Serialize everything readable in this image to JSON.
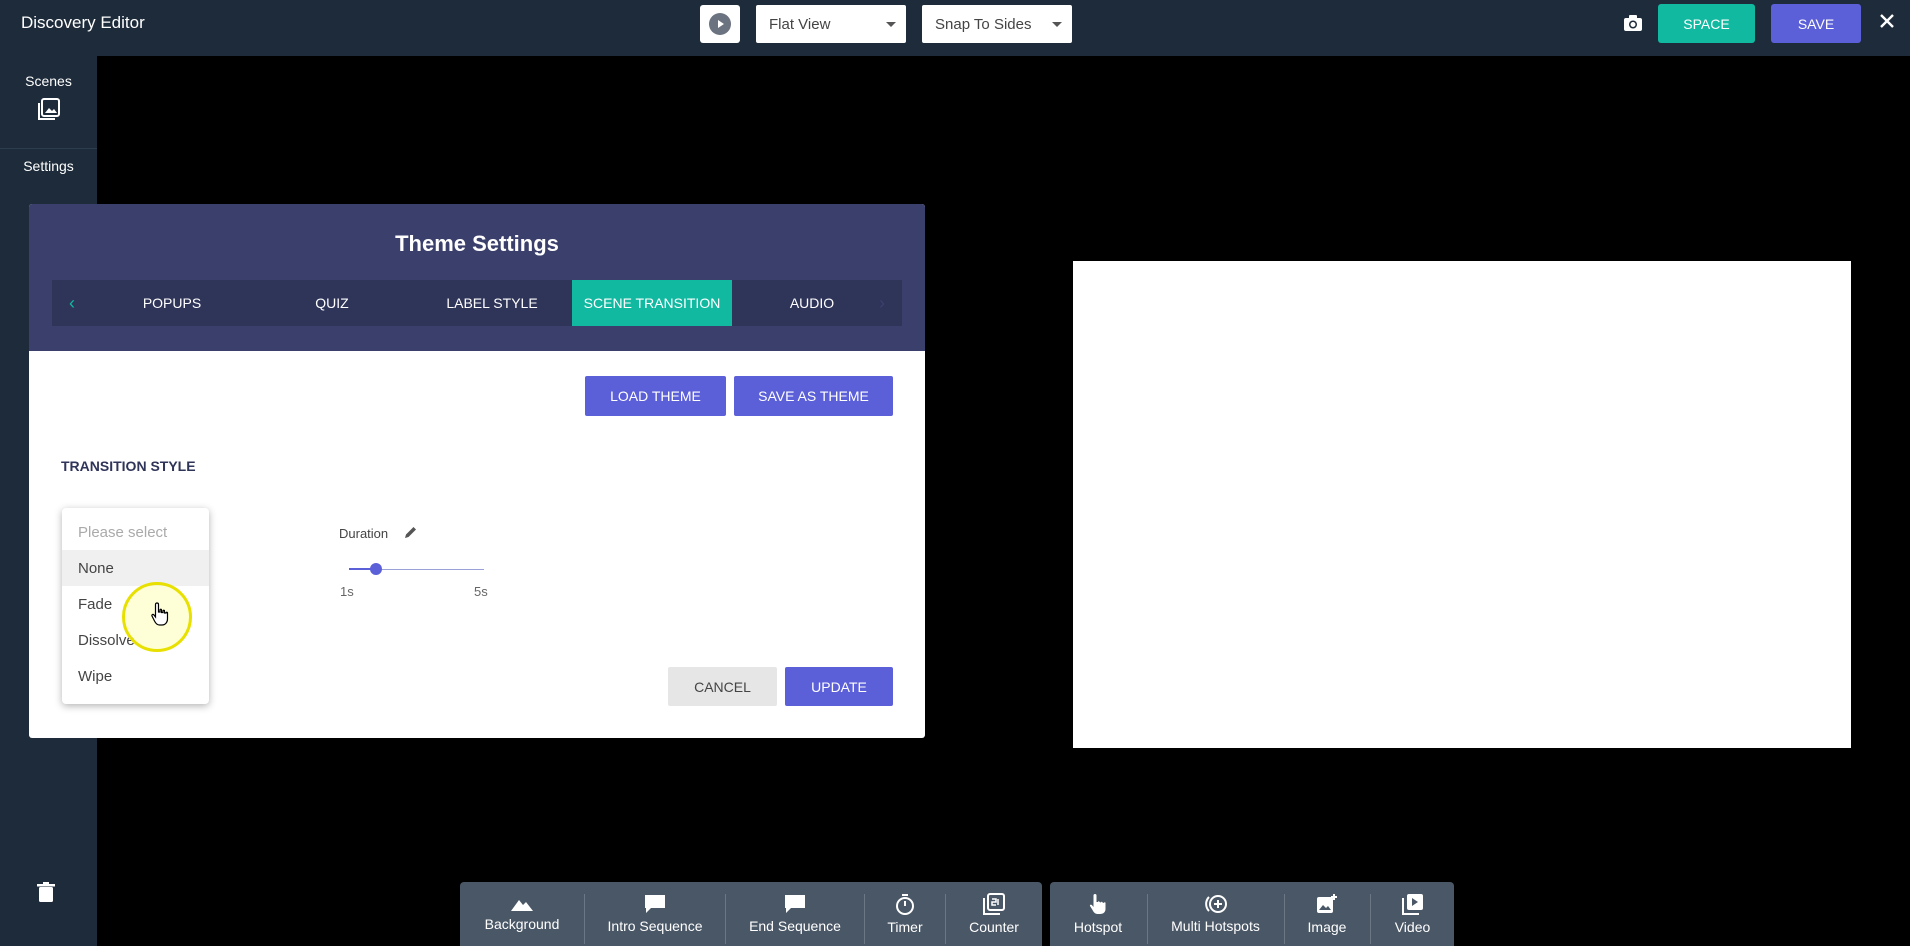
{
  "app": {
    "title": "Discovery Editor",
    "view_select": "Flat View",
    "snap_select": "Snap To Sides",
    "space_label": "SPACE",
    "save_label": "SAVE"
  },
  "sidebar": {
    "scenes_label": "Scenes",
    "settings_label": "Settings"
  },
  "modal": {
    "title": "Theme Settings",
    "tabs": [
      {
        "label": "POPUPS"
      },
      {
        "label": "QUIZ"
      },
      {
        "label": "LABEL STYLE"
      },
      {
        "label": "SCENE TRANSITION",
        "active": true
      },
      {
        "label": "AUDIO"
      }
    ],
    "load_theme": "LOAD THEME",
    "save_as_theme": "SAVE AS THEME",
    "section_title": "TRANSITION STYLE",
    "select": {
      "placeholder": "Please select",
      "options": [
        "None",
        "Fade",
        "Dissolve",
        "Wipe"
      ],
      "hovered": "None"
    },
    "duration": {
      "label": "Duration",
      "min_label": "1s",
      "max_label": "5s",
      "value_fraction": 0.2
    },
    "cancel": "CANCEL",
    "update": "UPDATE"
  },
  "toolbar": {
    "left": [
      "Background",
      "Intro Sequence",
      "End Sequence",
      "Timer",
      "Counter"
    ],
    "right": [
      "Hotspot",
      "Multi Hotspots",
      "Image",
      "Video"
    ]
  },
  "colors": {
    "accent_teal": "#10b9a0",
    "accent_purple": "#5b5fd8",
    "header_dark": "#1d2b3a",
    "modal_header": "#3a3f6b"
  }
}
